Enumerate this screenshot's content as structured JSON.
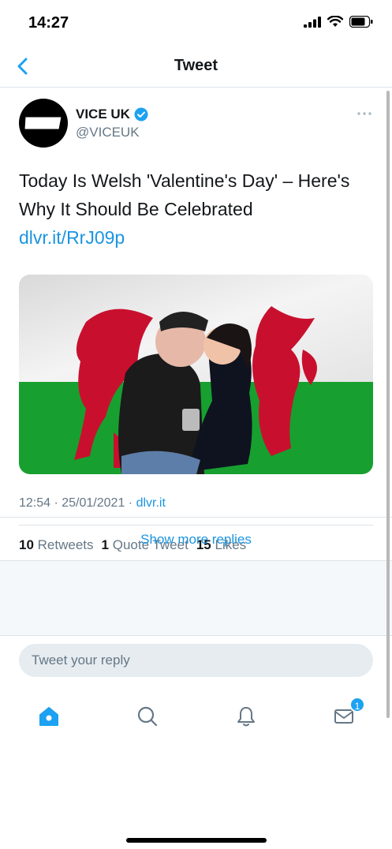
{
  "status_bar": {
    "time": "14:27"
  },
  "nav": {
    "title": "Tweet"
  },
  "tweet": {
    "author_name": "VICE UK",
    "handle": "@VICEUK",
    "avatar_text": "VICE",
    "text": "Today Is Welsh 'Valentine's Day' – Here's Why It Should Be Celebrated",
    "link": "dlvr.it/RrJ09p",
    "time": "12:54 · 25/01/2021 · ",
    "source": "dlvr.it",
    "retweets_count": "10",
    "retweets_label": "Retweets",
    "quotes_count": "1",
    "quotes_label": "Quote Tweet",
    "likes_count": "15",
    "likes_label": "Likes"
  },
  "show_more_label": "Show more replies",
  "reply": {
    "placeholder": "Tweet your reply"
  },
  "tabbar": {
    "messages_badge": "1"
  },
  "colors": {
    "accent": "#1da1f2",
    "link": "#1b95e0",
    "verified": "#1da1f2"
  }
}
